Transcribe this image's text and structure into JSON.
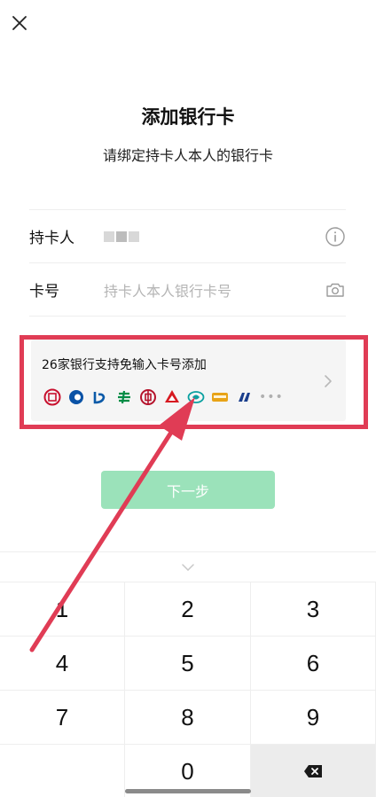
{
  "header": {
    "close_icon": "close-icon"
  },
  "page": {
    "title": "添加银行卡",
    "subtitle": "请绑定持卡人本人的银行卡"
  },
  "form": {
    "holder_label": "持卡人",
    "holder_info_icon": "info-icon",
    "card_label": "卡号",
    "card_placeholder": "持卡人本人银行卡号",
    "card_camera_icon": "camera-icon"
  },
  "support": {
    "text": "26家银行支持免输入卡号添加",
    "more": "•••",
    "chevron_icon": "chevron-right-icon",
    "banks": [
      {
        "icon": "bank-logo-1",
        "color": "#c8102e"
      },
      {
        "icon": "bank-logo-2",
        "color": "#0a52a6"
      },
      {
        "icon": "bank-logo-3",
        "color": "#0b5aa8"
      },
      {
        "icon": "bank-logo-4",
        "color": "#008c45"
      },
      {
        "icon": "bank-logo-5",
        "color": "#b5122b"
      },
      {
        "icon": "bank-logo-6",
        "color": "#d71920"
      },
      {
        "icon": "bank-logo-7",
        "color": "#0aa0a0"
      },
      {
        "icon": "bank-logo-8",
        "color": "#e8a317"
      },
      {
        "icon": "bank-logo-9",
        "color": "#1a3e8c"
      }
    ]
  },
  "actions": {
    "next_label": "下一步"
  },
  "keyboard": {
    "keys": [
      "1",
      "2",
      "3",
      "4",
      "5",
      "6",
      "7",
      "8",
      "9",
      "",
      "0",
      ""
    ],
    "delete_icon": "backspace-icon",
    "collapse_icon": "chevron-down-icon"
  },
  "colors": {
    "accent": "#9be2ba",
    "annotation": "#e03c55"
  }
}
